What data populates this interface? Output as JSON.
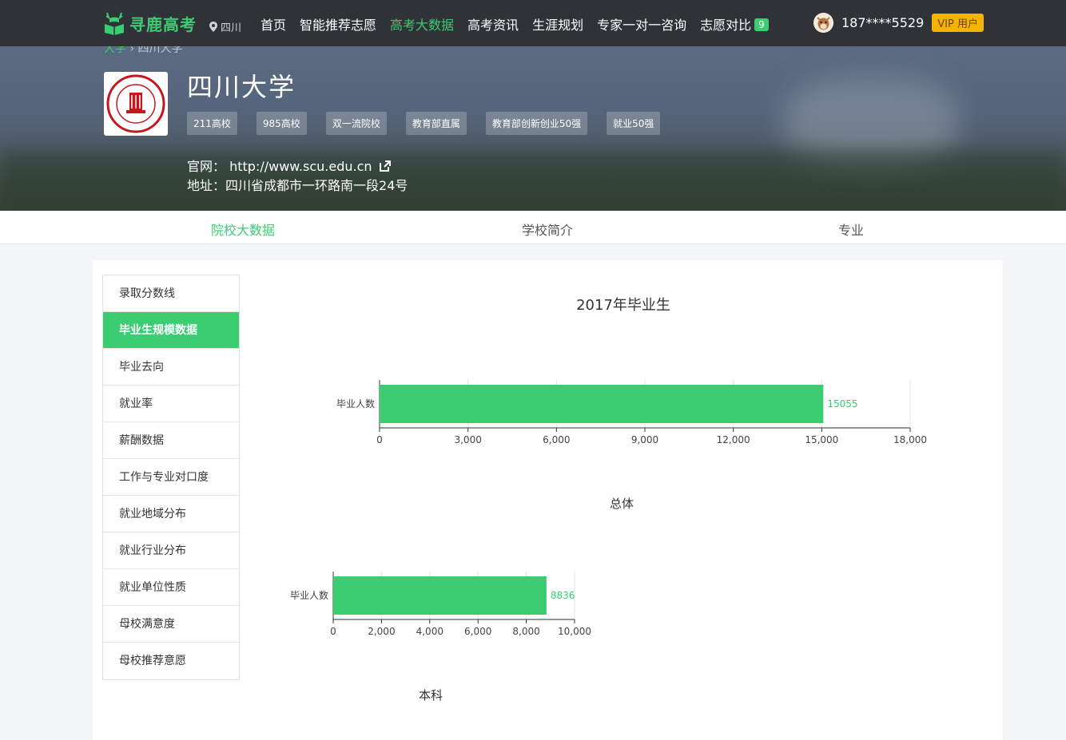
{
  "brand": {
    "name": "寻鹿高考",
    "accent": "#3ccc72"
  },
  "location": "四川",
  "nav": [
    {
      "label": "首页",
      "active": false
    },
    {
      "label": "智能推荐志愿",
      "active": false
    },
    {
      "label": "高考大数据",
      "active": true
    },
    {
      "label": "高考资讯",
      "active": false
    },
    {
      "label": "生涯规划",
      "active": false
    },
    {
      "label": "专家一对一咨询",
      "active": false
    },
    {
      "label": "志愿对比",
      "active": false,
      "badge": "9"
    }
  ],
  "user": {
    "phone": "187****5529",
    "vip": "VIP 用户"
  },
  "breadcrumb": [
    "大学",
    "四川大学"
  ],
  "school": {
    "name": "四川大学",
    "tags": [
      "211高校",
      "985高校",
      "双一流院校",
      "教育部直属",
      "教育部创新创业50强",
      "就业50强"
    ],
    "site_label": "官网：",
    "site_url": "http://www.scu.edu.cn",
    "address_label": "地址：",
    "address": "四川省成都市一环路南一段24号"
  },
  "tabs": [
    {
      "label": "院校大数据",
      "active": true
    },
    {
      "label": "学校简介",
      "active": false
    },
    {
      "label": "专业",
      "active": false
    }
  ],
  "sidebar": [
    {
      "label": "录取分数线",
      "active": false
    },
    {
      "label": "毕业生规模数据",
      "active": true
    },
    {
      "label": "毕业去向",
      "active": false
    },
    {
      "label": "就业率",
      "active": false
    },
    {
      "label": "薪酬数据",
      "active": false
    },
    {
      "label": "工作与专业对口度",
      "active": false
    },
    {
      "label": "就业地域分布",
      "active": false
    },
    {
      "label": "就业行业分布",
      "active": false
    },
    {
      "label": "就业单位性质",
      "active": false
    },
    {
      "label": "母校满意度",
      "active": false
    },
    {
      "label": "母校推荐意愿",
      "active": false
    }
  ],
  "chart_title": "2017年毕业生",
  "chart_data": [
    {
      "type": "bar",
      "orientation": "horizontal",
      "title": "总体",
      "categories": [
        "毕业人数"
      ],
      "values": [
        15055
      ],
      "xlim": [
        0,
        18000
      ],
      "ticks": [
        "0",
        "3,000",
        "6,000",
        "9,000",
        "12,000",
        "15,000",
        "18,000"
      ],
      "color": "#3ccc72"
    },
    {
      "type": "bar",
      "orientation": "horizontal",
      "title": "本科",
      "categories": [
        "毕业人数"
      ],
      "values": [
        8836
      ],
      "xlim": [
        0,
        10000
      ],
      "ticks": [
        "0",
        "2,000",
        "4,000",
        "6,000",
        "8,000",
        "10,000"
      ],
      "color": "#3ccc72"
    }
  ]
}
